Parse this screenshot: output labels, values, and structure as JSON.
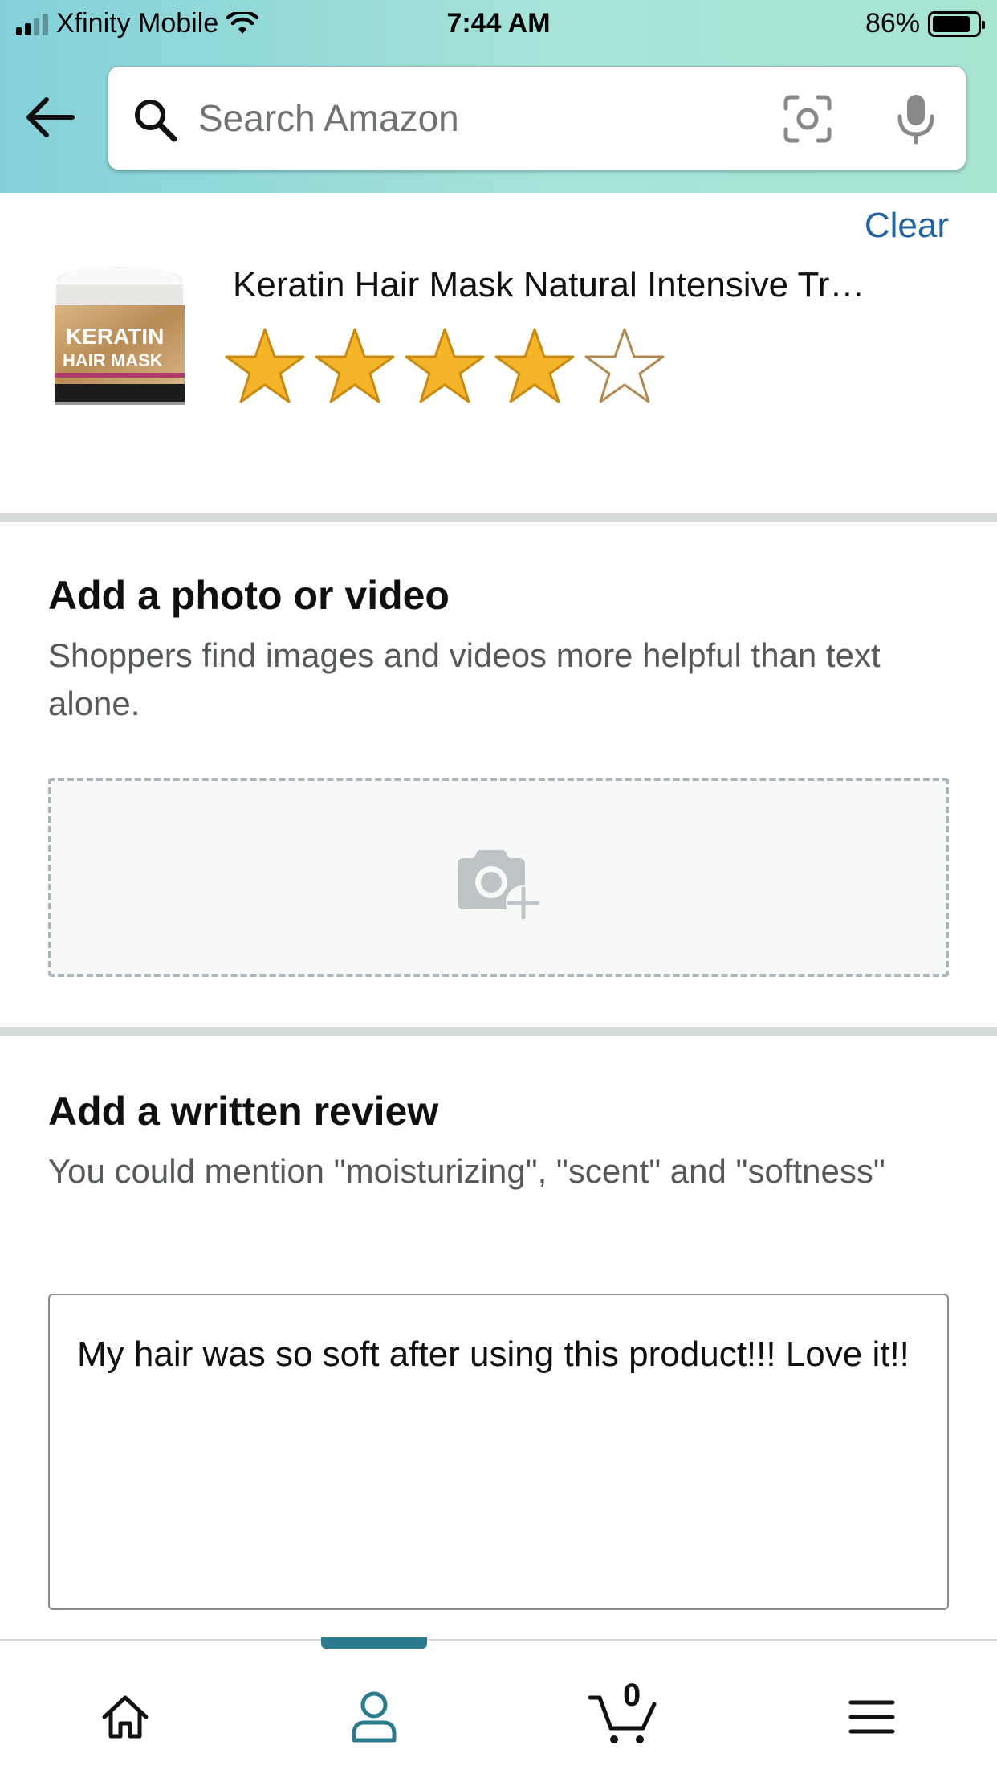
{
  "status_bar": {
    "carrier": "Xfinity Mobile",
    "time": "7:44 AM",
    "battery": "86%",
    "battery_level": 0.86
  },
  "search": {
    "placeholder": "Search Amazon",
    "back_icon": "arrow-left-icon",
    "search_icon": "magnifier-icon",
    "camera_icon": "camera-scan-icon",
    "mic_icon": "microphone-icon"
  },
  "product": {
    "clear_label": "Clear",
    "title": "Keratin Hair Mask Natural Intensive Tr…",
    "image_label_line1": "KERATIN",
    "image_label_line2": "HAIR MASK",
    "rating": 4,
    "max_rating": 5
  },
  "photo_section": {
    "title": "Add a photo or video",
    "subtitle": "Shoppers find images and videos more helpful than text alone.",
    "upload_icon": "camera-plus-icon"
  },
  "review_section": {
    "title": "Add a written review",
    "subtitle": "You could mention \"moisturizing\", \"scent\" and \"softness\"",
    "text": "My hair was so soft after using this product!!! Love it!!"
  },
  "bottom_nav": {
    "items": [
      "home-icon",
      "account-icon",
      "cart-icon",
      "menu-icon"
    ],
    "cart_count": "0",
    "active": "account-icon"
  },
  "colors": {
    "accent": "#2c7b8d",
    "link": "#2162a1",
    "star_fill": "#f4b42a",
    "header_start": "#84d0d9",
    "header_end": "#a8e4d2"
  }
}
